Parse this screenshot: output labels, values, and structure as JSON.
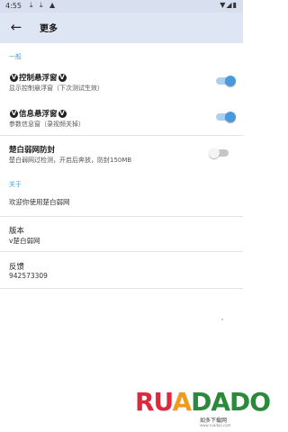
{
  "status": {
    "time": "4:55",
    "icons": "▼ ▲ ▮"
  },
  "appbar": {
    "back_icon": "arrow-left-icon",
    "title": "更多"
  },
  "sections": {
    "general": "一般",
    "about": "关于"
  },
  "items": {
    "float_control": {
      "title_pre": "",
      "title_main": "控制悬浮窗",
      "subtitle": "显示控制悬浮窗（下次测试生效）",
      "enabled": true
    },
    "float_info": {
      "title_main": "信息悬浮窗",
      "subtitle": "参数信息窗（录视频关掉）",
      "enabled": true
    },
    "anti_block": {
      "title": "楚白弱网防封",
      "subtitle": "楚白弱网过检测，开启后奔放，防封150MB",
      "enabled": false
    },
    "welcome": {
      "text": "欢迎你使用楚白弱网"
    },
    "version": {
      "title": "版本",
      "value": "v楚白弱网"
    },
    "feedback": {
      "title": "反馈",
      "value": "942573309"
    }
  },
  "badge": "V",
  "watermark": {
    "brand_r": "RU",
    "brand_o": "A",
    "brand_d": "DADO",
    "sub": "如多下载网",
    "url": "www.ruadao.com"
  },
  "colors": {
    "accent": "#4b9fd9",
    "appbar": "#dfe6f3"
  }
}
